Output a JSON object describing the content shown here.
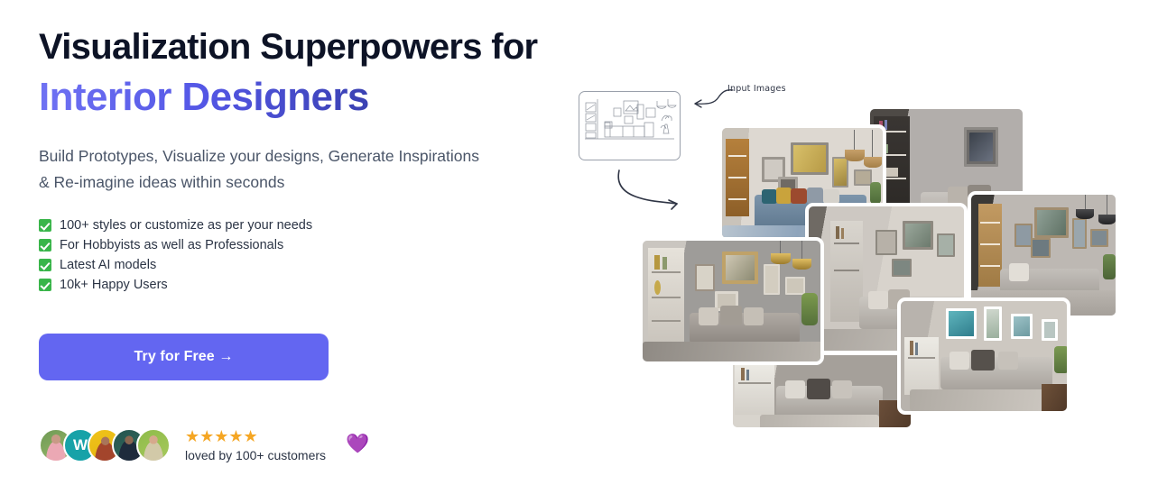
{
  "hero": {
    "headline_line1": "Visualization Superpowers for",
    "headline_line2": "Interior Designers",
    "subtext": "Build Prototypes, Visualize your designs, Generate Inspirations & Re-imagine ideas within seconds",
    "features": [
      "100+ styles or customize as per your needs",
      "For Hobbyists as well as Professionals",
      "Latest AI models",
      "10k+ Happy Users"
    ],
    "cta_label": "Try for Free  →"
  },
  "social_proof": {
    "stars": "★★★★★",
    "rating_text": "loved by 100+ customers",
    "heart": "💜",
    "avatars": [
      {
        "name": "avatar-customer-1",
        "initial": ""
      },
      {
        "name": "avatar-customer-2",
        "initial": "W"
      },
      {
        "name": "avatar-customer-3",
        "initial": ""
      },
      {
        "name": "avatar-customer-4",
        "initial": ""
      },
      {
        "name": "avatar-customer-5",
        "initial": ""
      }
    ]
  },
  "collage": {
    "input_label": "Input Images",
    "sketch_alt": "line sketch of living room with sofa, gallery wall and pendant lamps",
    "photos": [
      "living room with blue velvet sofa, gallery wall and rattan pendant lamps",
      "living room with grey sofa, dark shelving and patterned rug",
      "living room with grey sofa, white door and framed art",
      "living room with grey sofa, wooden bookcase and black pendant lamps",
      "living room with grey sofa, gold pendant lamps and potted plant",
      "living room with white sofa, bookshelf and beige rug",
      "living room with grey sofa, teal artwork and wood floor"
    ]
  },
  "colors": {
    "accent": "#6366f1",
    "headline_dark": "#0d1326",
    "gradient_start": "#6f72f3",
    "gradient_end": "#272f86",
    "check_green": "#39b54a",
    "star_gold": "#f5a623",
    "heart_purple": "#8b2fe0",
    "body_text": "#4a5568"
  }
}
